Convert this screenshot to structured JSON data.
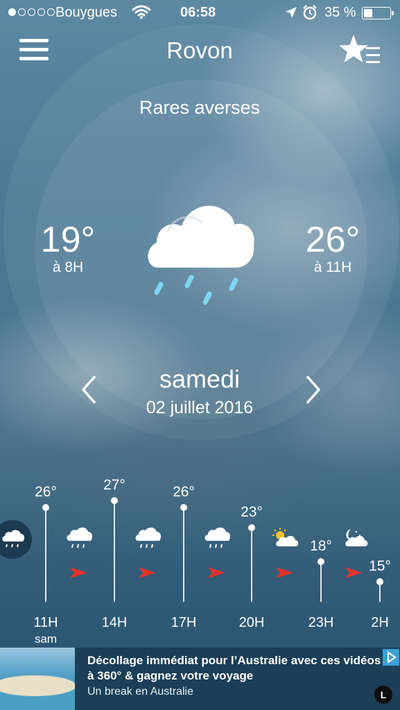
{
  "status_bar": {
    "carrier": "Bouygues",
    "time": "06:58",
    "battery": "35 %",
    "battery_level_percent": 35,
    "signal_bars_filled": 1,
    "signal_bars_total": 5
  },
  "header": {
    "city": "Rovon",
    "menu_icon": "hamburger-menu-icon",
    "favorites_icon": "star-list-icon"
  },
  "today": {
    "condition": "Rares averses",
    "icon": "cloud-rain-icon",
    "min_temp": "19°",
    "min_time": "à 8H",
    "max_temp": "26°",
    "max_time": "à 11H",
    "day": "samedi",
    "date": "02 juillet 2016"
  },
  "hourly": [
    {
      "hour": "11H",
      "sub": "sam",
      "temp": "26°",
      "icon": "cloud-rain-icon",
      "wind": "wind-arrow-icon"
    },
    {
      "hour": "14H",
      "sub": "",
      "temp": "27°",
      "icon": "cloud-rain-icon",
      "wind": "wind-arrow-icon"
    },
    {
      "hour": "17H",
      "sub": "",
      "temp": "26°",
      "icon": "cloud-rain-icon",
      "wind": "wind-arrow-icon"
    },
    {
      "hour": "20H",
      "sub": "",
      "temp": "23°",
      "icon": "sun-cloud-icon",
      "wind": "wind-arrow-icon"
    },
    {
      "hour": "23H",
      "sub": "",
      "temp": "18°",
      "icon": "moon-cloud-icon",
      "wind": "wind-arrow-icon"
    },
    {
      "hour": "2H",
      "sub": "",
      "temp": "15°",
      "icon": "",
      "wind": ""
    }
  ],
  "ad": {
    "title": "Décollage immédiat pour l’Australie avec ces vidéos à 360° & gagnez votre voyage",
    "subtitle": "Un break en Australie",
    "logo": "L"
  },
  "colors": {
    "wind_arrow": "#e2332b",
    "ad_background": "#1b3f57",
    "ad_choices": "#3ba1d6"
  }
}
